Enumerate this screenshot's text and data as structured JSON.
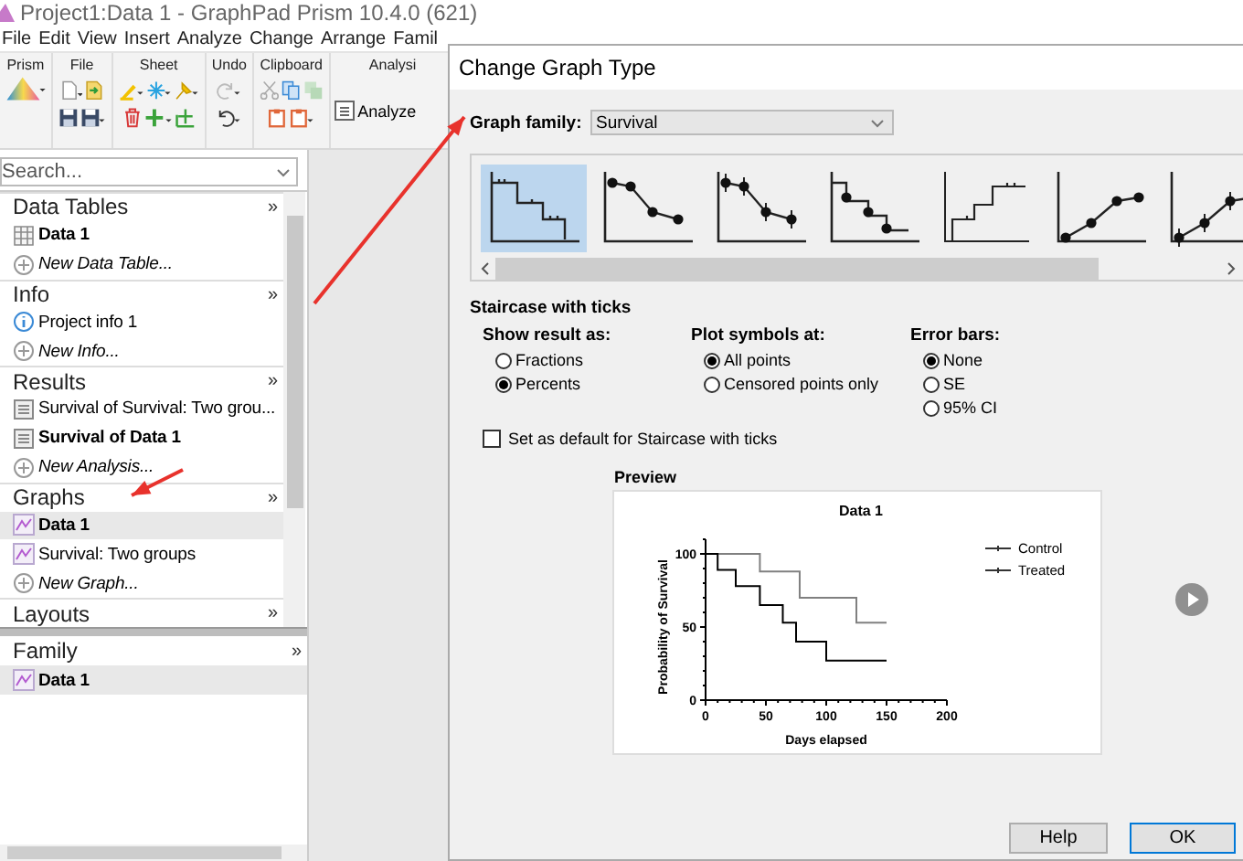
{
  "app_window": {
    "title": "Project1:Data 1 - GraphPad Prism 10.4.0 (621)"
  },
  "menu": [
    "File",
    "Edit",
    "View",
    "Insert",
    "Analyze",
    "Change",
    "Arrange",
    "Famil"
  ],
  "ribbon": [
    {
      "label": "Prism",
      "rows": [
        [
          {
            "kind": "logo"
          }
        ]
      ]
    },
    {
      "label": "File",
      "rows": [
        [
          {
            "kind": "page"
          },
          {
            "kind": "open"
          }
        ],
        [
          {
            "kind": "save"
          },
          {
            "kind": "save-as"
          }
        ]
      ]
    },
    {
      "label": "Sheet",
      "rows": [
        [
          {
            "kind": "marker"
          },
          {
            "kind": "snowflake"
          },
          {
            "kind": "pin"
          }
        ],
        [
          {
            "kind": "trash"
          },
          {
            "kind": "plus"
          },
          {
            "kind": "plus-bar"
          }
        ]
      ]
    },
    {
      "label": "Undo",
      "rows": [
        [
          {
            "kind": "redo"
          }
        ],
        [
          {
            "kind": "undo"
          }
        ]
      ]
    },
    {
      "label": "Clipboard",
      "rows": [
        [
          {
            "kind": "scissors"
          },
          {
            "kind": "copy"
          },
          {
            "kind": "stack"
          }
        ],
        [
          {
            "kind": "clipboard"
          },
          {
            "kind": "clipboard-menu"
          }
        ]
      ]
    },
    {
      "label": "Analysi",
      "button": "Analyze"
    }
  ],
  "search": {
    "placeholder": "Search..."
  },
  "navigator": [
    {
      "title": "Data Tables",
      "more": "»",
      "items": [
        {
          "label": "Data 1",
          "kind": "table",
          "active": true,
          "selected": false
        },
        {
          "label": "New Data Table...",
          "kind": "new",
          "active": false,
          "selected": false
        }
      ]
    },
    {
      "title": "Info",
      "more": "»",
      "items": [
        {
          "label": "Project info 1",
          "kind": "info",
          "active": false,
          "selected": false
        },
        {
          "label": "New Info...",
          "kind": "new",
          "active": false,
          "selected": false
        }
      ]
    },
    {
      "title": "Results",
      "more": "»",
      "items": [
        {
          "label": "Survival of Survival: Two grou...",
          "kind": "result",
          "active": false,
          "selected": false
        },
        {
          "label": "Survival of Data 1",
          "kind": "result",
          "active": true,
          "selected": false
        },
        {
          "label": "New Analysis...",
          "kind": "new",
          "active": false,
          "selected": false
        }
      ]
    },
    {
      "title": "Graphs",
      "more": "»",
      "items": [
        {
          "label": "Data 1",
          "kind": "graph",
          "active": true,
          "selected": true
        },
        {
          "label": "Survival: Two groups",
          "kind": "graph",
          "active": false,
          "selected": false
        },
        {
          "label": "New Graph...",
          "kind": "new",
          "active": false,
          "selected": false
        }
      ]
    },
    {
      "title": "Layouts",
      "more": "»"
    }
  ],
  "family_panel": {
    "title": "Family",
    "more": "»",
    "items": [
      {
        "label": "Data 1",
        "kind": "graph",
        "active": true,
        "selected": true
      }
    ]
  },
  "dialog": {
    "title": "Change Graph Type",
    "family_label": "Graph family:",
    "family_value": "Survival",
    "graph_types": [
      {
        "kind": "staircase-ticks",
        "selected": true
      },
      {
        "kind": "points-line",
        "selected": false
      },
      {
        "kind": "points-errors",
        "selected": false
      },
      {
        "kind": "staircase-points",
        "selected": false
      },
      {
        "kind": "staircase-up",
        "selected": false
      },
      {
        "kind": "points-up",
        "selected": false
      },
      {
        "kind": "points-up-errors",
        "selected": false
      }
    ],
    "type_name": "Staircase with ticks",
    "option_groups": [
      {
        "label": "Show result as:",
        "options": [
          {
            "label": "Fractions",
            "selected": false
          },
          {
            "label": "Percents",
            "selected": true
          }
        ]
      },
      {
        "label": "Plot symbols at:",
        "options": [
          {
            "label": "All points",
            "selected": true
          },
          {
            "label": "Censored points only",
            "selected": false
          }
        ]
      },
      {
        "label": "Error bars:",
        "options": [
          {
            "label": "None",
            "selected": true
          },
          {
            "label": "SE",
            "selected": false
          },
          {
            "label": "95% CI",
            "selected": false
          }
        ]
      }
    ],
    "default_checkbox": {
      "label": "Set as default for Staircase with ticks",
      "checked": false
    },
    "preview_label": "Preview",
    "preview": {
      "chart_data": {
        "type": "line",
        "title": "Data 1",
        "xlabel": "Days elapsed",
        "ylabel": "Probability of Survival",
        "x": [
          0,
          10,
          10,
          25,
          25,
          45,
          45,
          64,
          64,
          75,
          75,
          78,
          78,
          100,
          100,
          125,
          125,
          150
        ],
        "series": [
          {
            "name": "Control",
            "color": "#808080",
            "values": [
              100,
              100,
              100,
              100,
              100,
              100,
              88,
              88,
              88,
              88,
              88,
              88,
              70,
              70,
              70,
              70,
              53,
              53
            ]
          },
          {
            "name": "Treated",
            "color": "#000000",
            "values": [
              100,
              100,
              89,
              89,
              78,
              78,
              65,
              65,
              53,
              53,
              40,
              40,
              40,
              40,
              27,
              27,
              27,
              27
            ]
          }
        ],
        "xlim": [
          0,
          200
        ],
        "ylim": [
          0,
          110
        ],
        "xticks": [
          0,
          50,
          100,
          150,
          200
        ],
        "yticks": [
          0,
          50,
          100
        ]
      }
    },
    "buttons": [
      {
        "label": "Help",
        "default": false
      },
      {
        "label": "OK",
        "default": true
      }
    ]
  }
}
